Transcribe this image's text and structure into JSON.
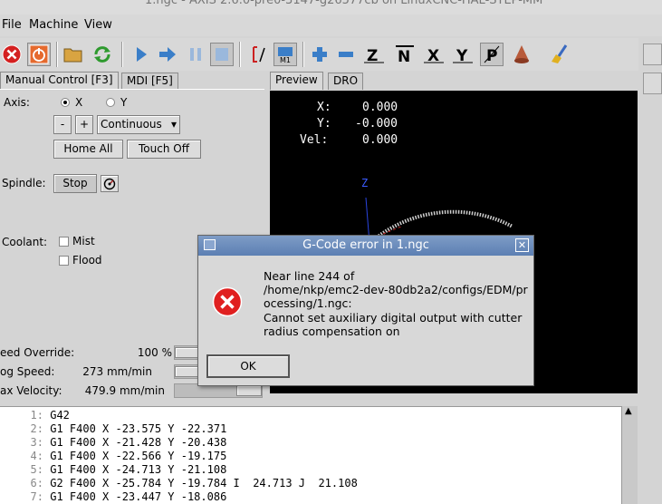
{
  "window": {
    "title": "1.ngc - AXIS 2.6.0-pre0-3147-g26577cb on LinuxCNC-HAL-STEP-MM"
  },
  "menu": {
    "file": "File",
    "machine": "Machine",
    "view": "View"
  },
  "tabs": {
    "manual": "Manual Control [F3]",
    "mdi": "MDI [F5]",
    "preview": "Preview",
    "dro": "DRO"
  },
  "manual": {
    "axis_label": "Axis:",
    "axis_x": "X",
    "axis_y": "Y",
    "minus": "-",
    "plus": "+",
    "jog_mode": "Continuous",
    "home_all": "Home All",
    "touch_off": "Touch Off",
    "spindle_label": "Spindle:",
    "spindle_stop": "Stop",
    "coolant_label": "Coolant:",
    "mist": "Mist",
    "flood": "Flood"
  },
  "dro": {
    "x_label": "X:",
    "x_value": "0.000",
    "y_label": "Y:",
    "y_value": "-0.000",
    "vel_label": "Vel:",
    "vel_value": "0.000",
    "z_axis_label": "Z"
  },
  "sliders": {
    "feed_label": "eed Override:",
    "feed_value": "100 %",
    "jog_label": "og Speed:",
    "jog_value": "273 mm/min",
    "maxvel_label": "ax Velocity:",
    "maxvel_value": "479.9 mm/min"
  },
  "gcode": [
    {
      "num": "1:",
      "text": "G42"
    },
    {
      "num": "2:",
      "text": "G1 F400 X -23.575 Y -22.371"
    },
    {
      "num": "3:",
      "text": "G1 F400 X -21.428 Y -20.438"
    },
    {
      "num": "4:",
      "text": "G1 F400 X -22.566 Y -19.175"
    },
    {
      "num": "5:",
      "text": "G1 F400 X -24.713 Y -21.108"
    },
    {
      "num": "6:",
      "text": "G2 F400 X -25.784 Y -19.784 I  24.713 J  21.108"
    },
    {
      "num": "7:",
      "text": "G1 F400 X -23.447 Y -18.086"
    }
  ],
  "dialog": {
    "title": "G-Code error in 1.ngc",
    "message": "Near line 244 of\n/home/nkp/emc2-dev-80db2a2/configs/EDM/pr\nocessing/1.ngc:\nCannot set auxiliary digital output with cutter\nradius compensation on",
    "ok": "OK"
  },
  "colors": {
    "error_red": "#e02020",
    "preview_bg": "#000000",
    "dialog_title": "#6a8abd"
  }
}
